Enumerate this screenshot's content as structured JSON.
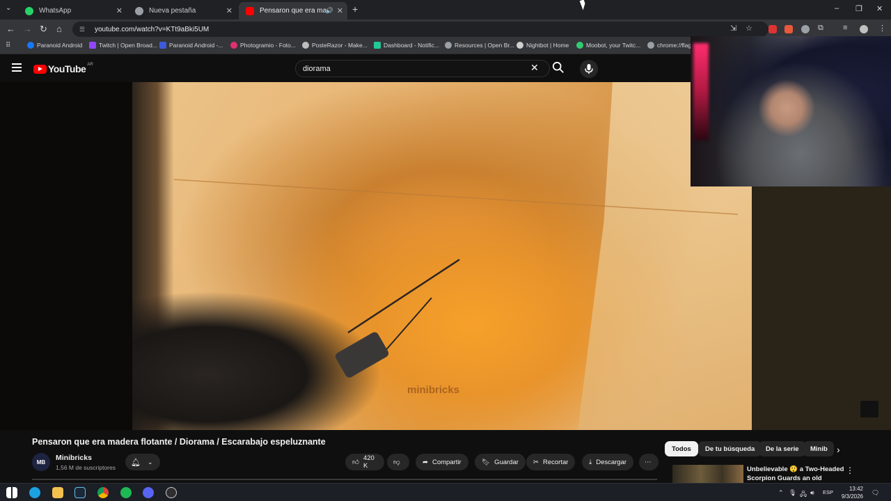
{
  "browser": {
    "tabs": [
      {
        "label": "WhatsApp",
        "icon": "whatsapp-icon",
        "color": "#25d366"
      },
      {
        "label": "Nueva pestaña",
        "icon": "globe-icon",
        "color": "#9aa0a6"
      },
      {
        "label": "Pensaron que era madera f",
        "icon": "youtube-icon",
        "color": "#ff0000"
      }
    ],
    "url": "youtube.com/watch?v=KTt9aBki5UM",
    "bookmarks": [
      {
        "label": "Paranoid Android",
        "color": "#1877f2"
      },
      {
        "label": "Twitch | Open Broad...",
        "color": "#9146ff"
      },
      {
        "label": "Paranoid Android -...",
        "color": "#3b5bdb"
      },
      {
        "label": "Photogramio - Foto...",
        "color": "#e1306c"
      },
      {
        "label": "PosteRazor - Make...",
        "color": "#bdbdbd"
      },
      {
        "label": "Dashboard - Notific...",
        "color": "#20c997"
      },
      {
        "label": "Resources | Open Br...",
        "color": "#9aa0a6"
      },
      {
        "label": "Nightbot | Home",
        "color": "#cfcfcf"
      },
      {
        "label": "Moobot, your Twitc...",
        "color": "#2ecc71"
      },
      {
        "label": "chrome://flag",
        "color": "#9aa0a6"
      }
    ]
  },
  "youtube": {
    "logo_text": "YouTube",
    "region": "AR",
    "search_value": "diorama",
    "watermark": "minibricks",
    "video_title": "Pensaron que era madera flotante / Diorama / Escarabajo espeluznante",
    "channel": {
      "name": "Minibricks",
      "subs": "1,56 M de suscriptores",
      "avatar_text": "MB"
    },
    "likes": "420 K",
    "actions": {
      "share": "Compartir",
      "save": "Guardar",
      "clip": "Recortar",
      "download": "Descargar"
    },
    "chips": [
      "Todos",
      "De tu búsqueda",
      "De la serie",
      "Minib"
    ],
    "recommendation": {
      "title": "Unbelievable 😲 a Two-Headed Scorpion Guards an old palace..."
    }
  },
  "taskbar": {
    "lang": "ESP",
    "time": "13:42",
    "date": "9/3/2026"
  }
}
